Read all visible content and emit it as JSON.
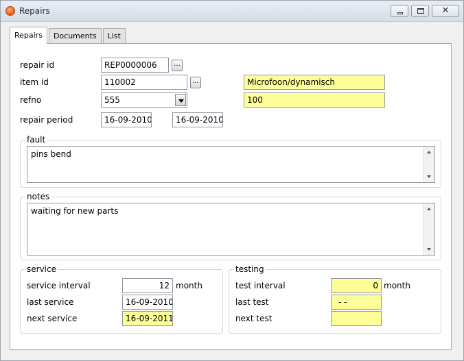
{
  "window": {
    "title": "Repairs"
  },
  "tabs": [
    {
      "label": "Repairs"
    },
    {
      "label": "Documents"
    },
    {
      "label": "List"
    }
  ],
  "repair": {
    "repair_id_label": "repair id",
    "repair_id_value": "REP0000006",
    "item_id_label": "item id",
    "item_id_value": "110002",
    "item_description": "Microfoon/dynamisch",
    "refno_label": "refno",
    "refno_value": "555",
    "refno_extra": "100",
    "repair_period_label": "repair period",
    "period_start": "16-09-2010",
    "period_end": "16-09-2010",
    "browse_label": "..."
  },
  "fault": {
    "title": "fault",
    "text": "pins bend"
  },
  "notes": {
    "title": "notes",
    "text": "waiting for new parts"
  },
  "service": {
    "title": "service",
    "interval_label": "service interval",
    "interval_value": "12",
    "interval_unit": "month",
    "last_label": "last service",
    "last_value": "16-09-2010",
    "next_label": "next service",
    "next_value": "16-09-2011"
  },
  "testing": {
    "title": "testing",
    "interval_label": "test interval",
    "interval_value": "0",
    "interval_unit": "month",
    "last_label": "last test",
    "last_value": "- -",
    "next_label": "next test",
    "next_value": ""
  },
  "icons": {
    "app": "repairs-app-icon",
    "minimize": "minimize-icon",
    "maximize": "maximize-icon",
    "close": "close-icon"
  },
  "colors": {
    "highlight_field": "#ffff99",
    "panel": "#ffffff",
    "chrome": "#f0f0f0"
  }
}
